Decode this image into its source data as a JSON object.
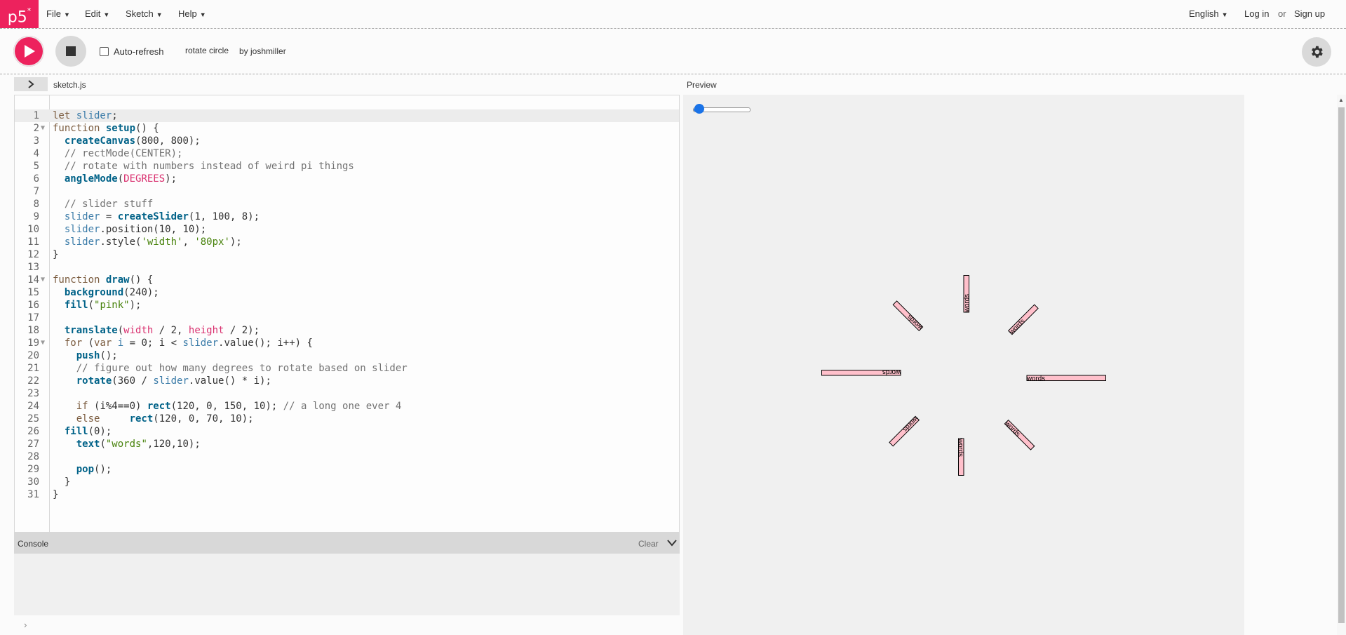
{
  "brand": {
    "logo_text": "p5",
    "logo_mark": "*",
    "accent": "#ed225d"
  },
  "nav": {
    "menus": [
      {
        "label": "File"
      },
      {
        "label": "Edit"
      },
      {
        "label": "Sketch"
      },
      {
        "label": "Help"
      }
    ],
    "language": "English",
    "login": "Log in",
    "or": "or",
    "signup": "Sign up"
  },
  "toolbar": {
    "auto_refresh_label": "Auto-refresh",
    "auto_refresh_checked": false,
    "sketch_name": "rotate circle",
    "by_author": "by joshmiller"
  },
  "editor": {
    "file_name": "sketch.js",
    "preview_label": "Preview",
    "active_line": 1,
    "lines": [
      {
        "n": "1",
        "fold": false,
        "tokens": [
          [
            "kw",
            "let "
          ],
          [
            "vr",
            "slider"
          ],
          [
            "nm",
            ";"
          ]
        ]
      },
      {
        "n": "2",
        "fold": true,
        "tokens": [
          [
            "kw",
            "function "
          ],
          [
            "fn",
            "setup"
          ],
          [
            "nm",
            "() {"
          ]
        ]
      },
      {
        "n": "3",
        "fold": false,
        "tokens": [
          [
            "nm",
            "  "
          ],
          [
            "fn",
            "createCanvas"
          ],
          [
            "nm",
            "(800, 800);"
          ]
        ]
      },
      {
        "n": "4",
        "fold": false,
        "tokens": [
          [
            "cm",
            "  // rectMode(CENTER);"
          ]
        ]
      },
      {
        "n": "5",
        "fold": false,
        "tokens": [
          [
            "cm",
            "  // rotate with numbers instead of weird pi things"
          ]
        ]
      },
      {
        "n": "6",
        "fold": false,
        "tokens": [
          [
            "nm",
            "  "
          ],
          [
            "fn",
            "angleMode"
          ],
          [
            "nm",
            "("
          ],
          [
            "cn",
            "DEGREES"
          ],
          [
            "nm",
            ");"
          ]
        ]
      },
      {
        "n": "7",
        "fold": false,
        "tokens": []
      },
      {
        "n": "8",
        "fold": false,
        "tokens": [
          [
            "cm",
            "  // slider stuff"
          ]
        ]
      },
      {
        "n": "9",
        "fold": false,
        "tokens": [
          [
            "nm",
            "  "
          ],
          [
            "vr",
            "slider"
          ],
          [
            "nm",
            " = "
          ],
          [
            "fn",
            "createSlider"
          ],
          [
            "nm",
            "(1, 100, 8);"
          ]
        ]
      },
      {
        "n": "10",
        "fold": false,
        "tokens": [
          [
            "nm",
            "  "
          ],
          [
            "vr",
            "slider"
          ],
          [
            "nm",
            ".position(10, 10);"
          ]
        ]
      },
      {
        "n": "11",
        "fold": false,
        "tokens": [
          [
            "nm",
            "  "
          ],
          [
            "vr",
            "slider"
          ],
          [
            "nm",
            ".style("
          ],
          [
            "st",
            "'width'"
          ],
          [
            "nm",
            ", "
          ],
          [
            "st",
            "'80px'"
          ],
          [
            "nm",
            ");"
          ]
        ]
      },
      {
        "n": "12",
        "fold": false,
        "tokens": [
          [
            "nm",
            "}"
          ]
        ]
      },
      {
        "n": "13",
        "fold": false,
        "tokens": []
      },
      {
        "n": "14",
        "fold": true,
        "tokens": [
          [
            "kw",
            "function "
          ],
          [
            "fn",
            "draw"
          ],
          [
            "nm",
            "() {"
          ]
        ]
      },
      {
        "n": "15",
        "fold": false,
        "tokens": [
          [
            "nm",
            "  "
          ],
          [
            "fn",
            "background"
          ],
          [
            "nm",
            "(240);"
          ]
        ]
      },
      {
        "n": "16",
        "fold": false,
        "tokens": [
          [
            "nm",
            "  "
          ],
          [
            "fn",
            "fill"
          ],
          [
            "nm",
            "("
          ],
          [
            "st",
            "\"pink\""
          ],
          [
            "nm",
            ");"
          ]
        ]
      },
      {
        "n": "17",
        "fold": false,
        "tokens": []
      },
      {
        "n": "18",
        "fold": false,
        "tokens": [
          [
            "nm",
            "  "
          ],
          [
            "fn",
            "translate"
          ],
          [
            "nm",
            "("
          ],
          [
            "cn",
            "width"
          ],
          [
            "nm",
            " / 2, "
          ],
          [
            "cn",
            "height"
          ],
          [
            "nm",
            " / 2);"
          ]
        ]
      },
      {
        "n": "19",
        "fold": true,
        "tokens": [
          [
            "nm",
            "  "
          ],
          [
            "kw",
            "for "
          ],
          [
            "nm",
            "("
          ],
          [
            "kw",
            "var "
          ],
          [
            "vr",
            "i"
          ],
          [
            "nm",
            " = 0; i < "
          ],
          [
            "vr",
            "slider"
          ],
          [
            "nm",
            ".value(); i++) {"
          ]
        ]
      },
      {
        "n": "20",
        "fold": false,
        "tokens": [
          [
            "nm",
            "    "
          ],
          [
            "fn",
            "push"
          ],
          [
            "nm",
            "();"
          ]
        ]
      },
      {
        "n": "21",
        "fold": false,
        "tokens": [
          [
            "cm",
            "    // figure out how many degrees to rotate based on slider"
          ]
        ]
      },
      {
        "n": "22",
        "fold": false,
        "tokens": [
          [
            "nm",
            "    "
          ],
          [
            "fn",
            "rotate"
          ],
          [
            "nm",
            "(360 / "
          ],
          [
            "vr",
            "slider"
          ],
          [
            "nm",
            ".value() * i);"
          ]
        ]
      },
      {
        "n": "23",
        "fold": false,
        "tokens": []
      },
      {
        "n": "24",
        "fold": false,
        "tokens": [
          [
            "nm",
            "    "
          ],
          [
            "kw",
            "if "
          ],
          [
            "nm",
            "(i%4==0) "
          ],
          [
            "fn",
            "rect"
          ],
          [
            "nm",
            "(120, 0, 150, 10); "
          ],
          [
            "cm",
            "// a long one ever 4"
          ]
        ]
      },
      {
        "n": "25",
        "fold": false,
        "tokens": [
          [
            "nm",
            "    "
          ],
          [
            "kw",
            "else     "
          ],
          [
            "fn",
            "rect"
          ],
          [
            "nm",
            "(120, 0, 70, 10);"
          ]
        ]
      },
      {
        "n": "26",
        "fold": false,
        "tokens": [
          [
            "nm",
            "  "
          ],
          [
            "fn",
            "fill"
          ],
          [
            "nm",
            "(0);"
          ]
        ]
      },
      {
        "n": "27",
        "fold": false,
        "tokens": [
          [
            "nm",
            "    "
          ],
          [
            "fn",
            "text"
          ],
          [
            "nm",
            "("
          ],
          [
            "st",
            "\"words\""
          ],
          [
            "nm",
            ",120,10);"
          ]
        ]
      },
      {
        "n": "28",
        "fold": false,
        "tokens": []
      },
      {
        "n": "29",
        "fold": false,
        "tokens": [
          [
            "nm",
            "    "
          ],
          [
            "fn",
            "pop"
          ],
          [
            "nm",
            "();"
          ]
        ]
      },
      {
        "n": "30",
        "fold": false,
        "tokens": [
          [
            "nm",
            "  }"
          ]
        ]
      },
      {
        "n": "31",
        "fold": false,
        "tokens": [
          [
            "nm",
            "}"
          ]
        ]
      }
    ]
  },
  "console": {
    "title": "Console",
    "clear_label": "Clear",
    "prompt": "›"
  },
  "preview": {
    "slider_value": 8,
    "slider_min": 1,
    "slider_max": 100,
    "rect_label": "words",
    "rect_fill": "#ffc0cb",
    "background": "#f0f0f0"
  }
}
